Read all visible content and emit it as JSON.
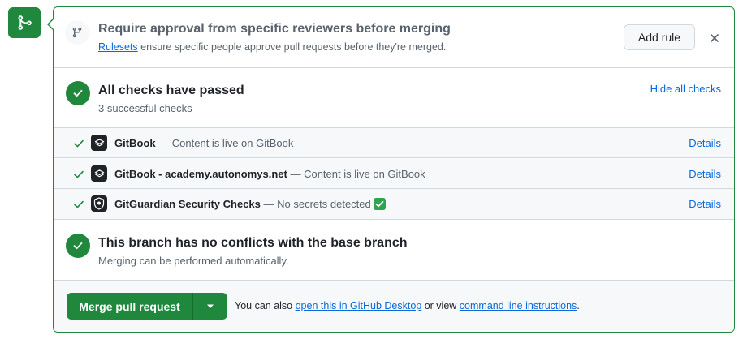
{
  "ruleset": {
    "title": "Require approval from specific reviewers before merging",
    "link_text": "Rulesets",
    "description": " ensure specific people approve pull requests before they're merged.",
    "add_rule_label": "Add rule"
  },
  "checks": {
    "title": "All checks have passed",
    "subtitle": "3 successful checks",
    "hide_label": "Hide all checks",
    "items": [
      {
        "name": "GitBook",
        "description": " — Content is live on GitBook",
        "details_label": "Details",
        "icon": "gitbook-icon"
      },
      {
        "name": "GitBook - academy.autonomys.net",
        "description": " — Content is live on GitBook",
        "details_label": "Details",
        "icon": "gitbook-icon"
      },
      {
        "name": "GitGuardian Security Checks",
        "description": " — No secrets detected",
        "details_label": "Details",
        "icon": "gitguardian-icon"
      }
    ]
  },
  "conflicts": {
    "title": "This branch has no conflicts with the base branch",
    "subtitle": "Merging can be performed automatically."
  },
  "merge": {
    "button_label": "Merge pull request",
    "note_prefix": "You can also ",
    "desktop_link": "open this in GitHub Desktop",
    "note_middle": " or view ",
    "cli_link": "command line instructions",
    "note_suffix": "."
  },
  "colors": {
    "success": "#1f883d",
    "link": "#0969da",
    "muted": "#59636e",
    "border": "#d1d9e0"
  }
}
